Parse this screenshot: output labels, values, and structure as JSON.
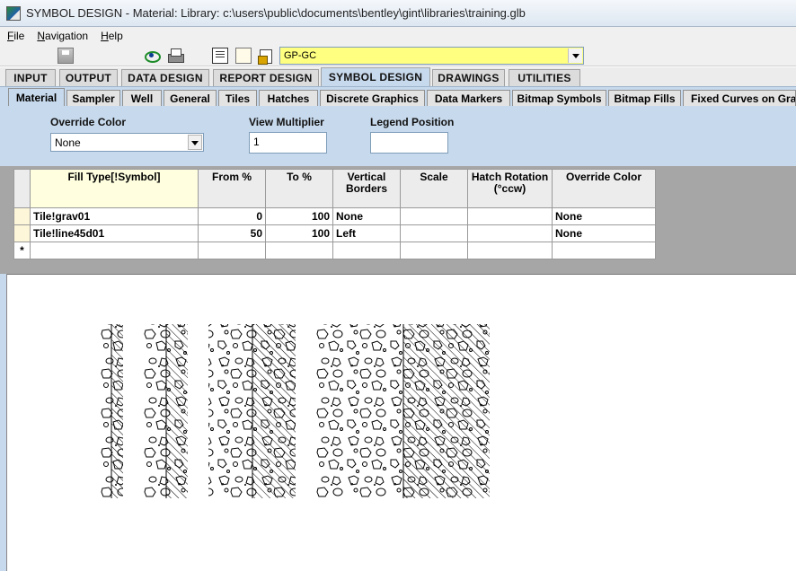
{
  "window": {
    "title": "SYMBOL DESIGN -  Material:  Library: c:\\users\\public\\documents\\bentley\\gint\\libraries\\training.glb"
  },
  "menu": [
    {
      "accel": "F",
      "rest": "ile"
    },
    {
      "accel": "N",
      "rest": "avigation"
    },
    {
      "accel": "H",
      "rest": "elp"
    }
  ],
  "toolbar": {
    "icons": [
      "save-icon",
      "view-icon",
      "print-icon",
      "list-icon",
      "new-document-icon",
      "open-library-icon"
    ],
    "project_combo_value": "GP-GC"
  },
  "main_tabs": [
    "INPUT",
    "OUTPUT",
    "DATA DESIGN",
    "REPORT DESIGN",
    "SYMBOL DESIGN",
    "DRAWINGS",
    "UTILITIES"
  ],
  "active_main_tab": "SYMBOL DESIGN",
  "sub_tabs": [
    "Material",
    "Sampler",
    "Well",
    "General",
    "Tiles",
    "Hatches",
    "Discrete Graphics",
    "Data Markers",
    "Bitmap Symbols",
    "Bitmap Fills",
    "Fixed Curves on Grap"
  ],
  "active_sub_tab": "Material",
  "properties": {
    "override_color_label": "Override Color",
    "override_color_value": "None",
    "view_multiplier_label": "View Multiplier",
    "view_multiplier_value": "1",
    "legend_position_label": "Legend Position",
    "legend_position_value": ""
  },
  "grid": {
    "headers": [
      "Fill Type[!Symbol]",
      "From %",
      "To %",
      "Vertical Borders",
      "Scale",
      "Hatch Rotation (°ccw)",
      "Override Color"
    ],
    "rows": [
      {
        "fill_type": "Tile!grav01",
        "from": "0",
        "to": "100",
        "vertical_borders": "None",
        "scale": "",
        "hatch_rotation": "",
        "override_color": "None"
      },
      {
        "fill_type": "Tile!line45d01",
        "from": "50",
        "to": "100",
        "vertical_borders": "Left",
        "scale": "",
        "hatch_rotation": "",
        "override_color": "None"
      }
    ],
    "new_row_marker": "*"
  },
  "colors": {
    "panel_blue": "#c7d9ec",
    "combo_yellow": "#ffff80",
    "grid_gray": "#a6a6a6"
  }
}
